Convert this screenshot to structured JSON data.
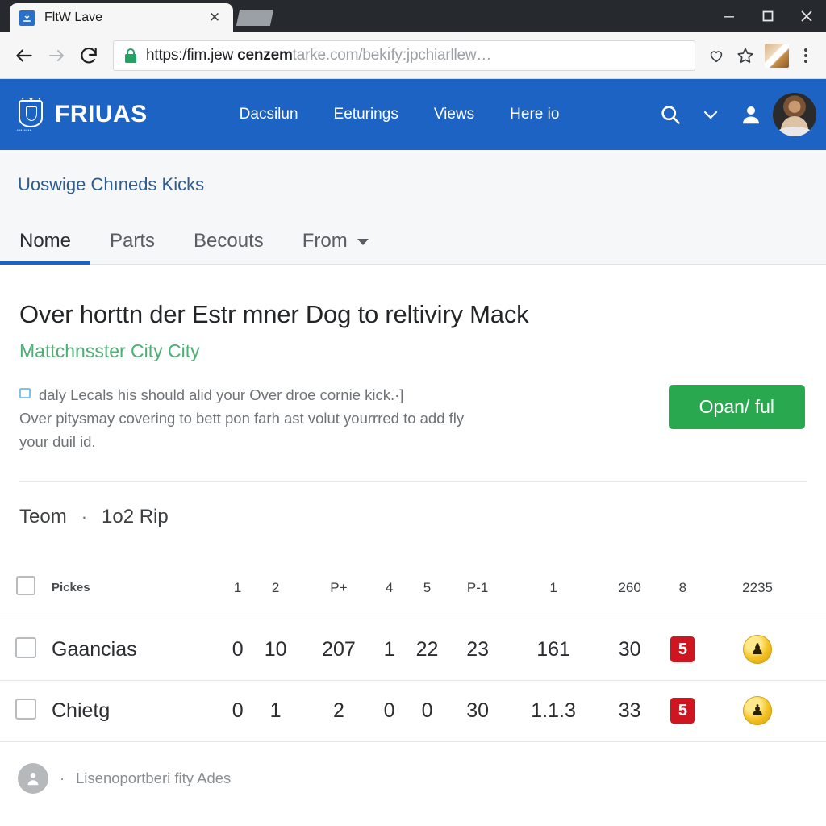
{
  "browser": {
    "tab": {
      "title": "FltW Lave",
      "favicon": "download-icon",
      "close": "✕"
    },
    "window_controls": {
      "minimize": "–",
      "maximize": "□",
      "close": "✕"
    },
    "toolbar": {
      "back": "←",
      "forward": "→",
      "reload": "⟳",
      "lock": "lock-icon",
      "url_scheme": "https:/fim.jew ",
      "url_bold": "cenzem",
      "url_rest": "tarke.com/bekı́fy:jpchiarllew…",
      "heart": "♡",
      "star": "☆",
      "menu": "kebab-menu"
    }
  },
  "site_nav": {
    "brand": "FRIUAS",
    "crest_stars": "• ★ •",
    "crest_ribbon": "••••••••",
    "links": [
      "Dacsilun",
      "Eeturings",
      "Views",
      "Here io"
    ],
    "search_icon": "search-icon",
    "chevron": "chevron-down-icon",
    "account_icon": "person-icon",
    "avatar": "user-avatar"
  },
  "breadcrumb": "Uoswige Chıneds Kicks",
  "tabs": {
    "items": [
      "Nome",
      "Parts",
      "Becouts",
      "From"
    ],
    "active_index": 0,
    "has_caret_on_last": true
  },
  "main": {
    "headline": "Over horttn der Estr mner Dog to reltiviry Mack",
    "subhead": "Mattchnsster City City",
    "body_line1": "daly Lecals his should alid your Over droe cornie kick.·]",
    "body_line2": "Over pitysmay covering to bett pon farh ast volut yourrred to add fly",
    "body_line3": "your duil id.",
    "cta_label": "Opan/ ful"
  },
  "section": {
    "title": "Teom",
    "separator": "·",
    "subtitle": "1o2 Rip"
  },
  "table": {
    "header": {
      "label": "Pickes",
      "columns": [
        "1",
        "2",
        "P+",
        "4",
        "5",
        "P-1",
        "1",
        "260",
        "8",
        "2235"
      ]
    },
    "rows": [
      {
        "name": "Gaancias",
        "values": [
          "0",
          "10",
          "207",
          "1",
          "22",
          "23",
          "161",
          "30"
        ],
        "badge": "5",
        "medal": "♟"
      },
      {
        "name": "Chietg",
        "values": [
          "0",
          "1",
          "2",
          "0",
          "0",
          "30",
          "1.1.3",
          "33"
        ],
        "badge": "5",
        "medal": "♟"
      }
    ]
  },
  "footer": {
    "separator": "·",
    "text": "Lisenoportberi fity Ades",
    "avatar_icon": "person-icon"
  },
  "colors": {
    "nav_blue": "#1c63c4",
    "cta_green": "#2aa84f",
    "subhead_green": "#4caf73",
    "badge_red": "#cf1520",
    "medal_gold": "#f5c324",
    "link_blue": "#2c5d91"
  }
}
